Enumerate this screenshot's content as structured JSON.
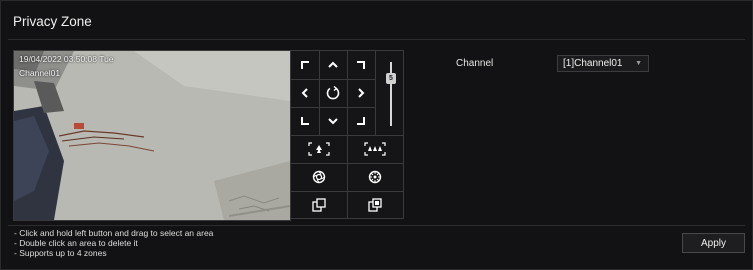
{
  "page": {
    "title": "Privacy Zone"
  },
  "video": {
    "timestamp": "19/04/2022 03:50:08 Tue",
    "channel_osd": "Channel01"
  },
  "ptz": {
    "buttons": [
      "arrow-up-left-icon",
      "arrow-up-icon",
      "arrow-up-right-icon",
      "arrow-left-icon",
      "auto-rotate-icon",
      "arrow-right-icon",
      "arrow-down-left-icon",
      "arrow-down-icon",
      "arrow-down-right-icon",
      "zoom-in-icon",
      "zoom-out-icon",
      "focus-near-icon",
      "focus-far-icon",
      "iris-close-icon",
      "iris-open-icon"
    ],
    "speed_value": "5"
  },
  "channel": {
    "label": "Channel",
    "selected": "[1]Channel01"
  },
  "hints": [
    "- Click and hold left button and drag to select an area",
    "- Double click an area to delete it",
    "- Supports up to 4 zones"
  ],
  "apply_label": "Apply"
}
